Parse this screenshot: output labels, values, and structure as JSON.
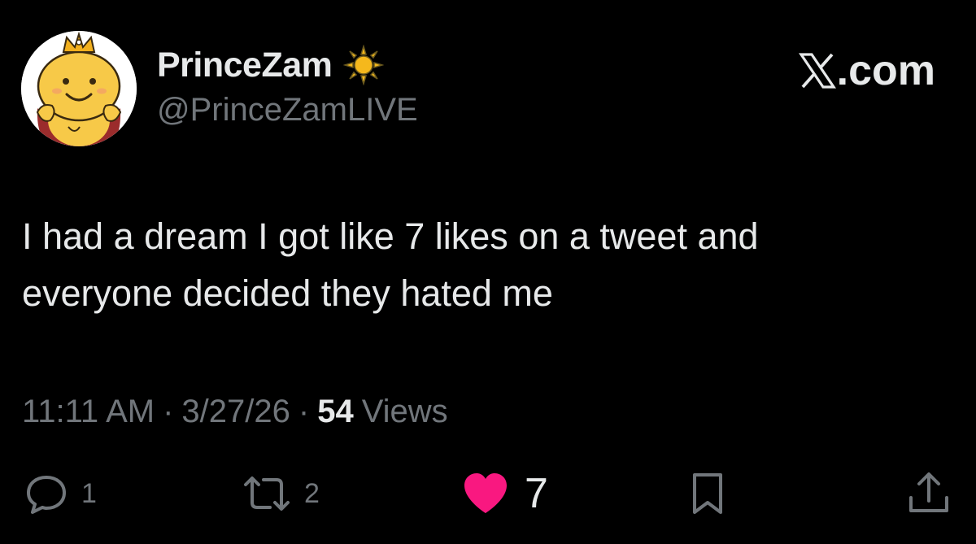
{
  "author": {
    "display_name": "PrinceZam",
    "badge_icon": "sun-icon",
    "handle": "@PrinceZamLIVE",
    "avatar_icon": "crowned-smiling-character-avatar"
  },
  "brand": {
    "logo_icon": "x-logo-icon",
    "suffix": ".com"
  },
  "tweet": {
    "text_lines": [
      "I had a dream I got like 7 likes on a tweet and",
      "everyone decided they hated me"
    ]
  },
  "meta": {
    "time": "11:11 AM",
    "separator": "·",
    "date": "3/27/26",
    "views_count": "54",
    "views_label": "Views"
  },
  "actions": {
    "reply": {
      "icon": "reply-bubble-icon",
      "count": "1"
    },
    "retweet": {
      "icon": "retweet-icon",
      "count": "2"
    },
    "like": {
      "icon": "heart-icon",
      "count": "7",
      "liked": true
    },
    "bookmark": {
      "icon": "bookmark-icon"
    },
    "share": {
      "icon": "share-icon"
    }
  },
  "colors": {
    "background": "#000000",
    "primary_text": "#e7e9ea",
    "secondary_text": "#71767b",
    "like": "#f91880",
    "sun": "#f5b81c"
  }
}
